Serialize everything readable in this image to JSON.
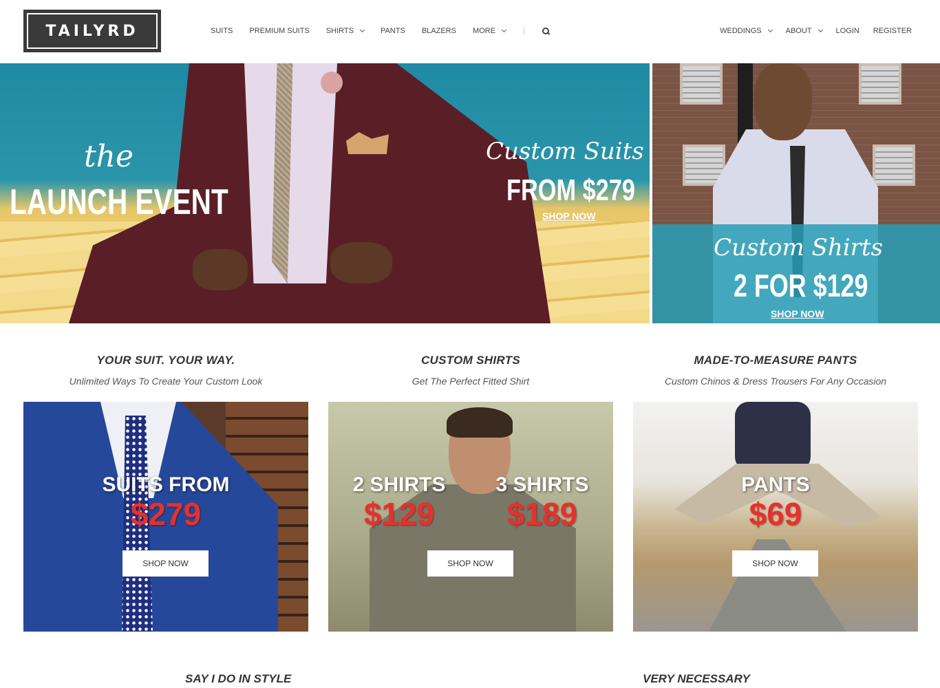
{
  "brand": {
    "logo_text": "TAILYRD"
  },
  "nav": {
    "left": [
      {
        "label": "SUITS",
        "dropdown": false
      },
      {
        "label": "PREMIUM SUITS",
        "dropdown": false
      },
      {
        "label": "SHIRTS",
        "dropdown": true
      },
      {
        "label": "PANTS",
        "dropdown": false
      },
      {
        "label": "BLAZERS",
        "dropdown": false
      },
      {
        "label": "MORE",
        "dropdown": true
      }
    ],
    "search_icon": "search-icon",
    "right": [
      {
        "label": "WEDDINGS",
        "dropdown": true
      },
      {
        "label": "ABOUT",
        "dropdown": true
      },
      {
        "label": "LOGIN",
        "dropdown": false
      },
      {
        "label": "REGISTER",
        "dropdown": false
      }
    ]
  },
  "hero": {
    "main": {
      "the": "the",
      "headline": "LAUNCH EVENT",
      "custom": "Custom Suits",
      "price": "FROM $279",
      "cta": "SHOP NOW"
    },
    "side": {
      "custom": "Custom Shirts",
      "price": "2 FOR $129",
      "cta": "SHOP NOW"
    }
  },
  "categories": [
    {
      "title": "YOUR SUIT. YOUR WAY.",
      "subtitle": "Unlimited Ways To Create Your Custom Look",
      "promo_line1": "SUITS FROM",
      "promo_line2": "$279",
      "button": "SHOP NOW"
    },
    {
      "title": "CUSTOM SHIRTS",
      "subtitle": "Get The Perfect Fitted Shirt",
      "promo_a_line1": "2 SHIRTS",
      "promo_a_line2": "$129",
      "promo_b_line1": "3 SHIRTS",
      "promo_b_line2": "$189",
      "button": "SHOP NOW"
    },
    {
      "title": "MADE-TO-MEASURE PANTS",
      "subtitle": "Custom Chinos & Dress Trousers For Any Occasion",
      "promo_line1": "PANTS",
      "promo_line2": "$69",
      "button": "SHOP NOW"
    }
  ],
  "bottom": {
    "left_heading": "SAY I DO IN STYLE",
    "right_heading": "VERY NECESSARY"
  },
  "colors": {
    "accent_price": "#e8302a",
    "hero_teal": "#2a95aa",
    "logo_bg": "#3a3a3a"
  }
}
